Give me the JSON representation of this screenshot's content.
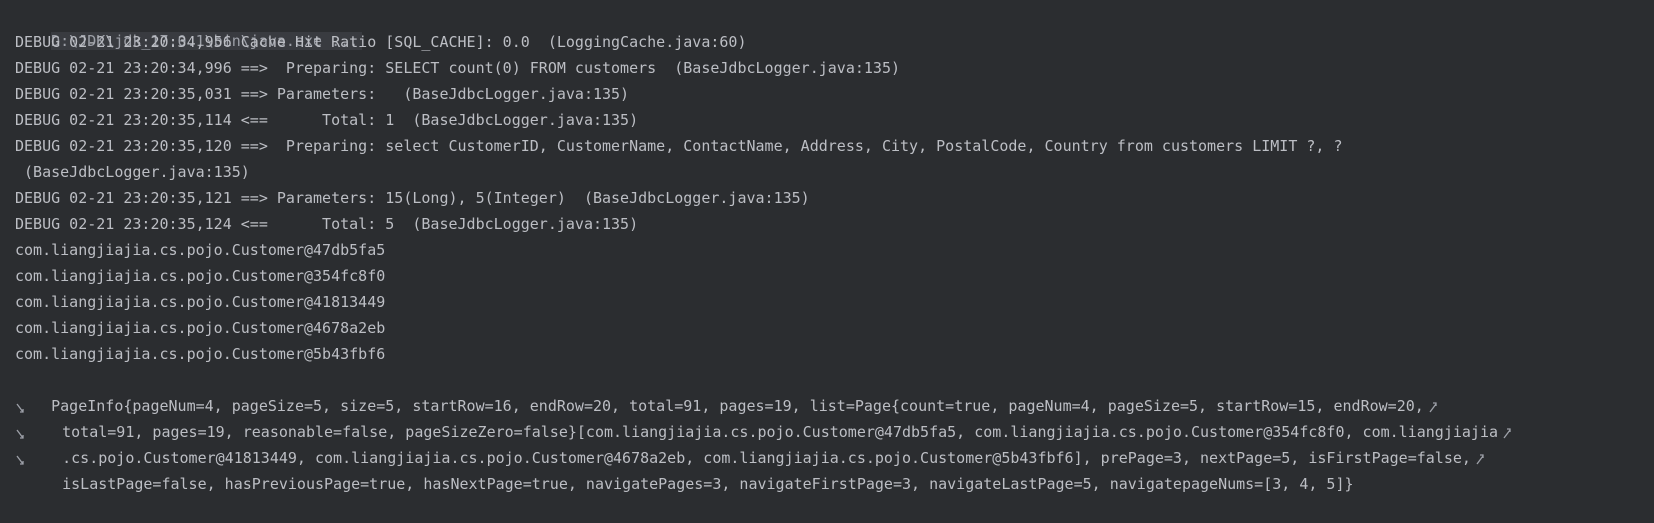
{
  "console": {
    "command_line": "D:\\JDK\\jdk_17.0.1\\bin\\java.exe ...",
    "lines": [
      "DEBUG 02-21 23:20:34,956 Cache Hit Ratio [SQL_CACHE]: 0.0  (LoggingCache.java:60)",
      "DEBUG 02-21 23:20:34,996 ==>  Preparing: SELECT count(0) FROM customers  (BaseJdbcLogger.java:135)",
      "DEBUG 02-21 23:20:35,031 ==> Parameters:   (BaseJdbcLogger.java:135)",
      "DEBUG 02-21 23:20:35,114 <==      Total: 1  (BaseJdbcLogger.java:135)",
      "DEBUG 02-21 23:20:35,120 ==>  Preparing: select CustomerID, CustomerName, ContactName, Address, City, PostalCode, Country from customers LIMIT ?, ?",
      " (BaseJdbcLogger.java:135)",
      "DEBUG 02-21 23:20:35,121 ==> Parameters: 15(Long), 5(Integer)  (BaseJdbcLogger.java:135)",
      "DEBUG 02-21 23:20:35,124 <==      Total: 5  (BaseJdbcLogger.java:135)",
      "com.liangjiajia.cs.pojo.Customer@47db5fa5",
      "com.liangjiajia.cs.pojo.Customer@354fc8f0",
      "com.liangjiajia.cs.pojo.Customer@41813449",
      "com.liangjiajia.cs.pojo.Customer@4678a2eb",
      "com.liangjiajia.cs.pojo.Customer@5b43fbf6"
    ],
    "pageinfo_lines": [
      "PageInfo{pageNum=4, pageSize=5, size=5, startRow=16, endRow=20, total=91, pages=19, list=Page{count=true, pageNum=4, pageSize=5, startRow=15, endRow=20,",
      "total=91, pages=19, reasonable=false, pageSizeZero=false}[com.liangjiajia.cs.pojo.Customer@47db5fa5, com.liangjiajia.cs.pojo.Customer@354fc8f0, com.liangjiajia",
      ".cs.pojo.Customer@41813449, com.liangjiajia.cs.pojo.Customer@4678a2eb, com.liangjiajia.cs.pojo.Customer@5b43fbf6], prePage=3, nextPage=5, isFirstPage=false,",
      "isLastPage=false, hasPreviousPage=true, hasNextPage=true, navigatePages=3, navigateFirstPage=3, navigateLastPage=5, navigatepageNums=[3, 4, 5]}"
    ],
    "soft_wrap_icon": "soft-wrap-icon",
    "colors": {
      "background": "#2b2d30",
      "text": "#bcbec4",
      "command_highlight": "#393b40"
    }
  }
}
